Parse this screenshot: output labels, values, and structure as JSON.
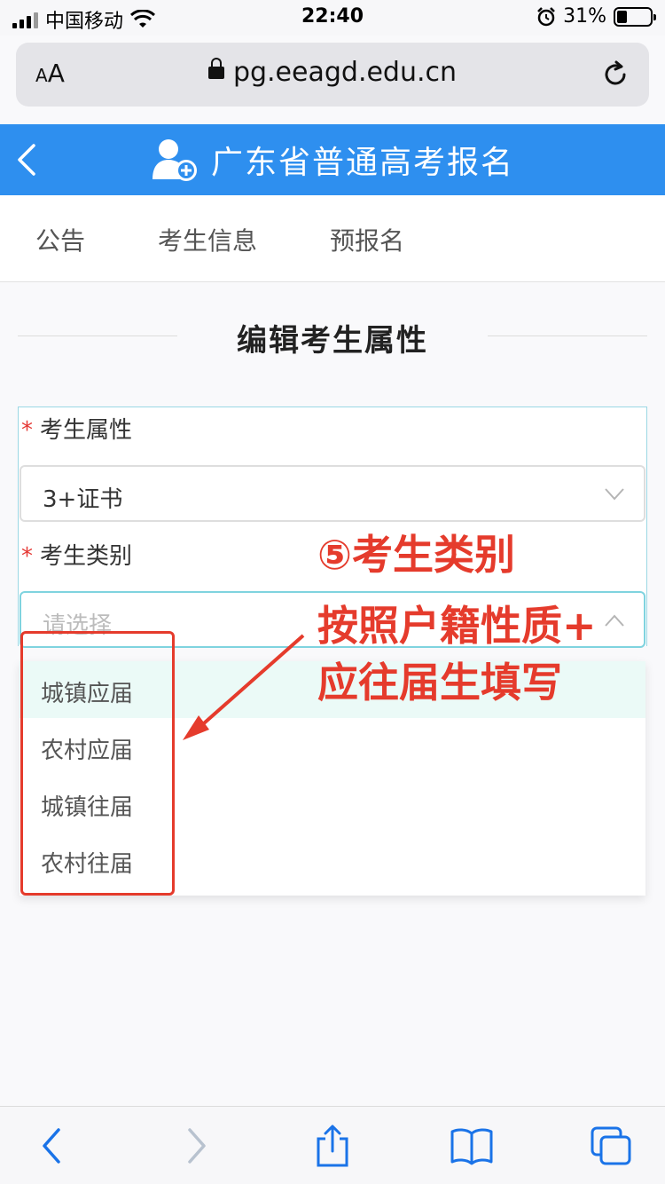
{
  "status_bar": {
    "carrier": "中国移动",
    "time": "22:40",
    "battery_percent": "31%",
    "battery_level": 0.31
  },
  "browser": {
    "text_size_label": "AA",
    "address": "pg.eeagd.edu.cn"
  },
  "header": {
    "title": "广东省普通高考报名"
  },
  "tabs": [
    {
      "label": "公告"
    },
    {
      "label": "考生信息"
    },
    {
      "label": "预报名"
    }
  ],
  "section_title": "编辑考生属性",
  "form": {
    "required_mark": "*",
    "attribute": {
      "label": "考生属性",
      "value": "3+证书"
    },
    "category": {
      "label": "考生类别",
      "placeholder": "请选择",
      "options": [
        {
          "label": "城镇应届"
        },
        {
          "label": "农村应届"
        },
        {
          "label": "城镇往届"
        },
        {
          "label": "农村往届"
        }
      ],
      "highlighted_option": "城镇应届"
    }
  },
  "annotation": {
    "lines": [
      "⑤考生类别",
      "按照户籍性质+",
      "应往届生填写"
    ],
    "color": "#e53b2c"
  },
  "colors": {
    "header_blue": "#2e8fef",
    "safari_blue": "#1a73e8",
    "required_red": "#e53935"
  }
}
